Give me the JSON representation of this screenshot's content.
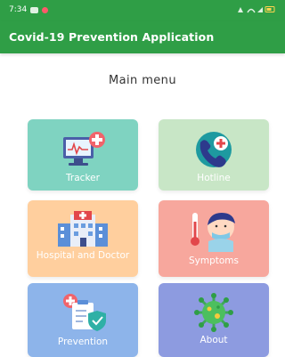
{
  "status_bar": {
    "time": "7:34"
  },
  "app_bar": {
    "title": "Covid-19 Prevention Application",
    "color": "#2f9e46"
  },
  "heading": "Main menu",
  "tiles": [
    {
      "label": "Tracker",
      "icon": "computer-monitor-icon",
      "color": "#7fd3c1"
    },
    {
      "label": "Hotline",
      "icon": "phone-medical-icon",
      "color": "#c8e6c6"
    },
    {
      "label": "Hospital and Doctor",
      "icon": "hospital-building-icon",
      "color": "#ffcf9e"
    },
    {
      "label": "Symptoms",
      "icon": "sick-person-thermometer-icon",
      "color": "#f7a79d"
    },
    {
      "label": "Prevention",
      "icon": "medical-shield-icon",
      "color": "#8db4ea"
    },
    {
      "label": "About",
      "icon": "virus-icon",
      "color": "#8d9be0"
    }
  ]
}
